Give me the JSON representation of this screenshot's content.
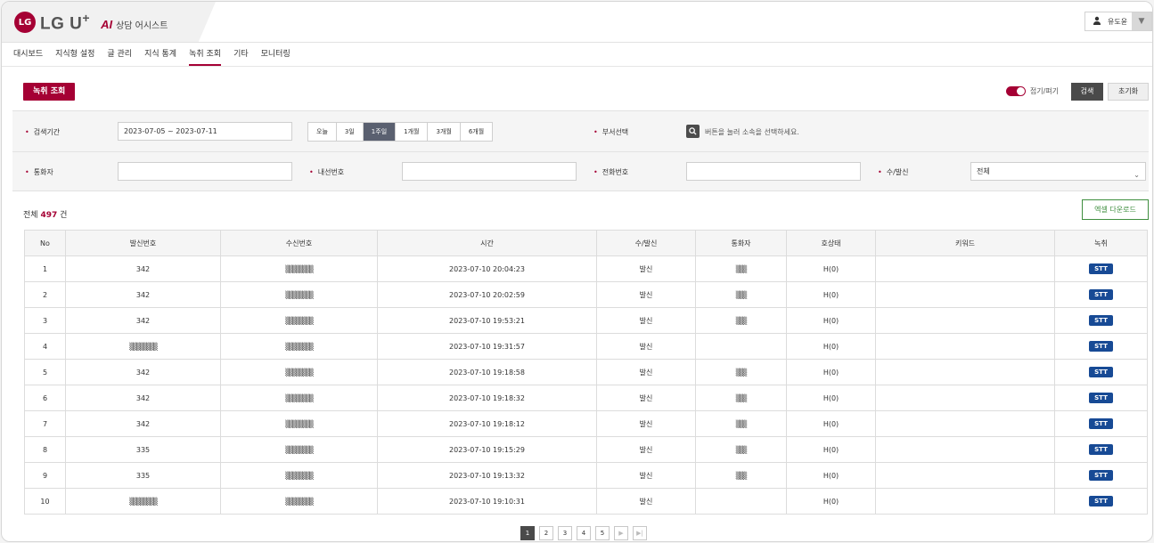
{
  "header": {
    "logo_mark": "LG",
    "brand": "LG U",
    "brand_plus": "+",
    "ai": "AI",
    "product": "상담 어시스트",
    "user_name": "유도윤",
    "user_icon": "person-icon",
    "dropdown_icon": "triangle-down-icon"
  },
  "nav": {
    "items": [
      {
        "label": "대시보드",
        "active": false
      },
      {
        "label": "지식형 설정",
        "active": false
      },
      {
        "label": "글 관리",
        "active": false
      },
      {
        "label": "지식 통계",
        "active": false
      },
      {
        "label": "녹취 조회",
        "active": true
      },
      {
        "label": "기타",
        "active": false
      },
      {
        "label": "모니터링",
        "active": false
      }
    ]
  },
  "toolbar": {
    "page_button": "녹취 조회",
    "toggle_label": "접기/펴기",
    "toggle_on": true,
    "search": "검색",
    "reset": "초기화"
  },
  "filters": {
    "period_label": "검색기간",
    "period_value": "2023-07-05 ~ 2023-07-11",
    "period_options": [
      "오늘",
      "3일",
      "1주일",
      "1개월",
      "3개월",
      "6개월"
    ],
    "period_active": 2,
    "dept_label": "부서선택",
    "dept_hint": "버튼을 눌러 소속을 선택하세요.",
    "caller_label": "통화자",
    "caller_value": "",
    "ext_label": "내선번호",
    "ext_value": "",
    "phone_label": "전화번호",
    "phone_value": "",
    "direction_label": "수/발신",
    "direction_value": "전체"
  },
  "summary": {
    "prefix": "전체",
    "count": "497",
    "suffix": "건",
    "excel": "엑셀 다운로드"
  },
  "table": {
    "columns": [
      "No",
      "발신번호",
      "수신번호",
      "시간",
      "수/발신",
      "통화자",
      "호상태",
      "키워드",
      "녹취"
    ],
    "rows": [
      {
        "no": "1",
        "from": "342",
        "to": "▒▒▒▒▒▒▒▒",
        "time": "2023-07-10 20:04:23",
        "dir": "발신",
        "caller": "▒▒▒",
        "status": "H(0)",
        "keyword": "",
        "rec": "STT"
      },
      {
        "no": "2",
        "from": "342",
        "to": "▒▒▒▒▒▒▒▒",
        "time": "2023-07-10 20:02:59",
        "dir": "발신",
        "caller": "▒▒▒",
        "status": "H(0)",
        "keyword": "",
        "rec": "STT"
      },
      {
        "no": "3",
        "from": "342",
        "to": "▒▒▒▒▒▒▒▒",
        "time": "2023-07-10 19:53:21",
        "dir": "발신",
        "caller": "▒▒▒",
        "status": "H(0)",
        "keyword": "",
        "rec": "STT"
      },
      {
        "no": "4",
        "from": "▒▒▒▒▒▒▒▒",
        "to": "▒▒▒▒▒▒▒▒",
        "time": "2023-07-10 19:31:57",
        "dir": "발신",
        "caller": "",
        "status": "H(0)",
        "keyword": "",
        "rec": "STT"
      },
      {
        "no": "5",
        "from": "342",
        "to": "▒▒▒▒▒▒▒▒",
        "time": "2023-07-10 19:18:58",
        "dir": "발신",
        "caller": "▒▒▒",
        "status": "H(0)",
        "keyword": "",
        "rec": "STT"
      },
      {
        "no": "6",
        "from": "342",
        "to": "▒▒▒▒▒▒▒▒",
        "time": "2023-07-10 19:18:32",
        "dir": "발신",
        "caller": "▒▒▒",
        "status": "H(0)",
        "keyword": "",
        "rec": "STT"
      },
      {
        "no": "7",
        "from": "342",
        "to": "▒▒▒▒▒▒▒▒",
        "time": "2023-07-10 19:18:12",
        "dir": "발신",
        "caller": "▒▒▒",
        "status": "H(0)",
        "keyword": "",
        "rec": "STT"
      },
      {
        "no": "8",
        "from": "335",
        "to": "▒▒▒▒▒▒▒▒",
        "time": "2023-07-10 19:15:29",
        "dir": "발신",
        "caller": "▒▒▒",
        "status": "H(0)",
        "keyword": "",
        "rec": "STT"
      },
      {
        "no": "9",
        "from": "335",
        "to": "▒▒▒▒▒▒▒▒",
        "time": "2023-07-10 19:13:32",
        "dir": "발신",
        "caller": "▒▒▒",
        "status": "H(0)",
        "keyword": "",
        "rec": "STT"
      },
      {
        "no": "10",
        "from": "▒▒▒▒▒▒▒▒",
        "to": "▒▒▒▒▒▒▒▒",
        "time": "2023-07-10 19:10:31",
        "dir": "발신",
        "caller": "",
        "status": "H(0)",
        "keyword": "",
        "rec": "STT"
      }
    ]
  },
  "pagination": {
    "pages": [
      "1",
      "2",
      "3",
      "4",
      "5"
    ],
    "active": "1",
    "next_icon": "next-arrow-icon",
    "last_icon": "last-arrow-icon"
  },
  "colors": {
    "brand": "#a50034",
    "stt": "#174a95",
    "excel": "#3e8e3e",
    "active_seg": "#5a6070"
  }
}
